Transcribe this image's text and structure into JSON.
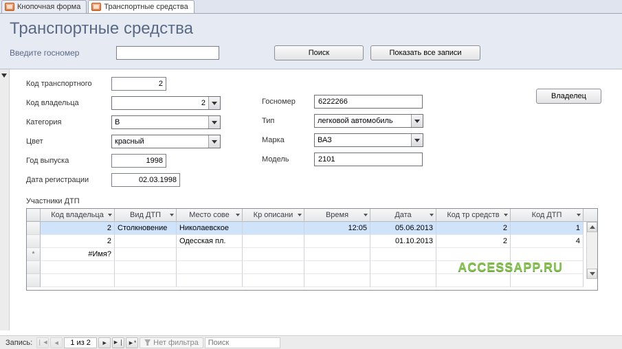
{
  "tabs": [
    {
      "label": "Кнопочная форма"
    },
    {
      "label": "Транспортные средства"
    }
  ],
  "header": {
    "title": "Транспортные средства",
    "gosnomer_label": "Введите госномер",
    "gosnomer_value": "",
    "search_btn": "Поиск",
    "show_all_btn": "Показать все записи"
  },
  "form": {
    "left": {
      "code_vehicle_label": "Код транспортного",
      "code_vehicle_value": "2",
      "code_owner_label": "Код владельца",
      "code_owner_value": "2",
      "category_label": "Категория",
      "category_value": "B",
      "color_label": "Цвет",
      "color_value": "красный",
      "year_label": "Год выпуска",
      "year_value": "1998",
      "regdate_label": "Дата регистрации",
      "regdate_value": "02.03.1998"
    },
    "right": {
      "gosnomer_label": "Госномер",
      "gosnomer_value": "6222266",
      "type_label": "Тип",
      "type_value": "легковой автомобиль",
      "brand_label": "Марка",
      "brand_value": "ВАЗ",
      "model_label": "Модель",
      "model_value": "2101"
    },
    "owner_btn": "Владелец",
    "sub_title": "Участники ДТП"
  },
  "grid": {
    "columns": [
      "Код владельца",
      "Вид ДТП",
      "Место сове",
      "Кр описани",
      "Время",
      "Дата",
      "Код тр средств",
      "Код ДТП"
    ],
    "rows": [
      {
        "owner": "2",
        "kind": "Столкновение",
        "place": "Николаевское",
        "desc": "",
        "time": "12:05",
        "date": "05.06.2013",
        "veh": "2",
        "dtp": "1"
      },
      {
        "owner": "2",
        "kind": "",
        "place": "Одесская пл.",
        "desc": "",
        "time": "",
        "date": "01.10.2013",
        "veh": "2",
        "dtp": "4"
      }
    ],
    "new_row_owner": "#Имя?"
  },
  "recnav": {
    "label": "Запись:",
    "pos": "1 из 2",
    "filter": "Нет фильтра",
    "search_placeholder": "Поиск"
  },
  "watermark": "ACCESSAPP.RU"
}
